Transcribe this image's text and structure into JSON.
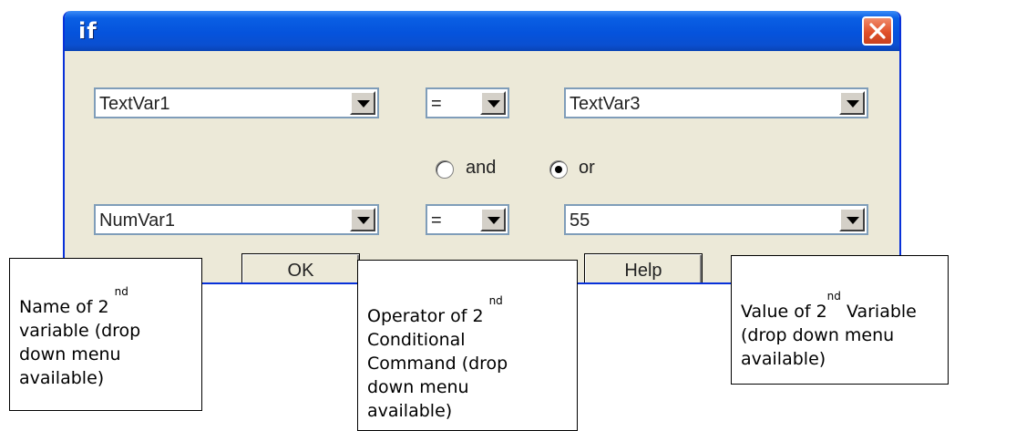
{
  "dialog": {
    "title": "if",
    "row1": {
      "variable": "TextVar1",
      "operator": "=",
      "value": "TextVar3"
    },
    "logic": {
      "and_label": "and",
      "or_label": "or",
      "selected": "or"
    },
    "row2": {
      "variable": "NumVar1",
      "operator": "=",
      "value": "55"
    },
    "buttons": {
      "ok": "OK",
      "help": "Help"
    }
  },
  "annotations": {
    "name2": {
      "pre": "Name of 2",
      "sup": "nd",
      "post": [
        "variable (drop",
        "down menu",
        "available)"
      ]
    },
    "operator2": {
      "pre": "Operator of 2",
      "sup": "nd",
      "post": [
        "Conditional",
        "Command (drop",
        "down menu",
        "available)"
      ]
    },
    "value2": {
      "pre": "Value of 2",
      "sup": "nd",
      "post": [
        " Variable",
        "(drop down menu",
        "available)"
      ]
    }
  },
  "icons": {
    "close": "close-x-icon",
    "dropdown": "chevron-down-icon",
    "radio": "radio-icon"
  }
}
